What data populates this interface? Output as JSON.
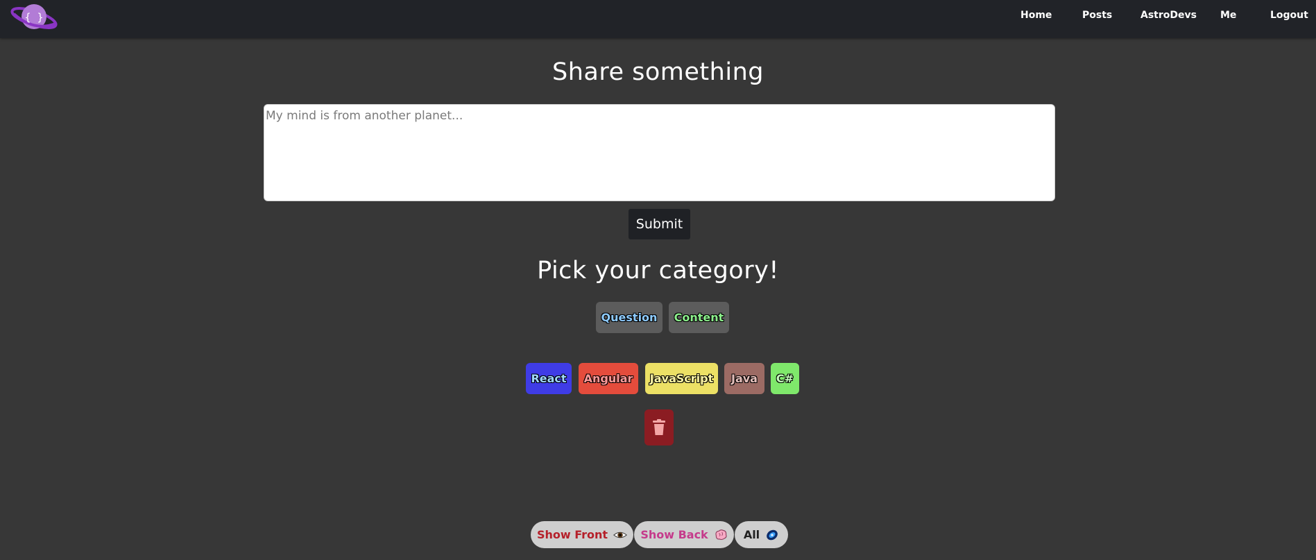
{
  "navbar": {
    "logo_text": "{ }",
    "links": [
      "Home",
      "Posts",
      "AstroDevs",
      "Me",
      "Logout"
    ]
  },
  "share": {
    "title": "Share something",
    "placeholder": "My mind is from another planet...",
    "submit_label": "Submit"
  },
  "category": {
    "title": "Pick your category!",
    "types": [
      {
        "label": "Question",
        "color": "#8ecbff"
      },
      {
        "label": "Content",
        "color": "#8cf08c"
      }
    ],
    "tags": [
      {
        "label": "React",
        "bg": "#3f3ce6",
        "color": "#9fd8ff"
      },
      {
        "label": "Angular",
        "bg": "#e44c3c",
        "color": "#ff9a9a"
      },
      {
        "label": "JavaScript",
        "bg": "#ece065",
        "color": "#fff7a6"
      },
      {
        "label": "Java",
        "bg": "#9c6b64",
        "color": "#e5c0bc"
      },
      {
        "label": "C#",
        "bg": "#7fe86b",
        "color": "#c7ffbf"
      }
    ],
    "delete_icon": "trash-icon"
  },
  "filters": {
    "front_label": "Show Front",
    "front_icon": "eye-icon",
    "back_label": "Show Back",
    "back_icon": "brain-icon",
    "all_label": "All",
    "all_icon": "galaxy-icon"
  }
}
